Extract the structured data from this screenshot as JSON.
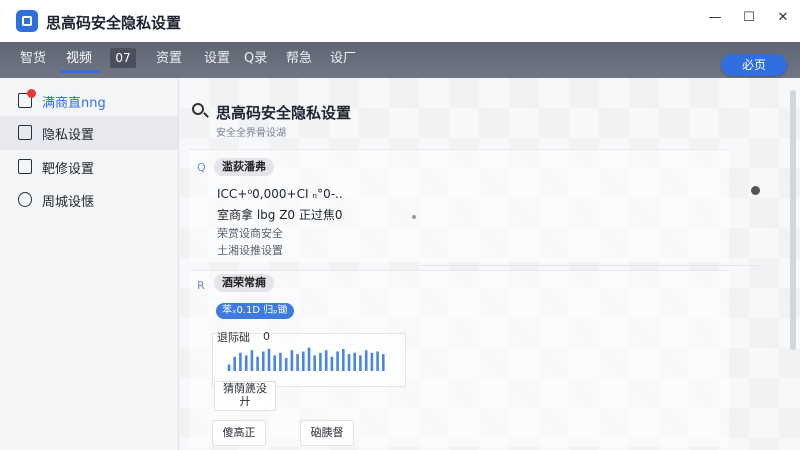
{
  "window": {
    "title": "思高码安全隐私设置",
    "controls": {
      "minimize": "—",
      "maximize": "☐",
      "close": "✕"
    }
  },
  "menubar": {
    "items": [
      "智货",
      "视频",
      "资置",
      "设置",
      "Q录",
      "帮急",
      "设厂"
    ],
    "active_index": 1,
    "box_label": "07",
    "action_button": "必页"
  },
  "sidebar": {
    "items": [
      {
        "label": "满商直nng",
        "icon": "bell-icon",
        "badge": true
      },
      {
        "label": "隐私设置",
        "icon": "document-icon",
        "selected": true
      },
      {
        "label": "靶修设置",
        "icon": "page-icon"
      },
      {
        "label": "周城设惬",
        "icon": "gear-icon"
      }
    ]
  },
  "main": {
    "title": "思高码安全隐私设置",
    "subtitle": "安全全界骨设湖",
    "section1": {
      "tag": "滥荻潘弗",
      "lines": [
        "ICC+⁰0,000+CⅠ  ₙ°0-..",
        "室商拿 lbg Z0 正过焦0",
        "荣赏设商安全",
        "土湘设推设置"
      ]
    },
    "section2": {
      "icon_text": "R",
      "tag": "酒荣常痈",
      "pill": "苯ₓ0.1D 归ₚ锄",
      "stat_label": "退际础",
      "stat_value": "0",
      "bars": [
        0.25,
        0.55,
        0.7,
        0.6,
        0.8,
        0.55,
        0.75,
        0.85,
        0.6,
        0.7,
        0.5,
        0.8,
        0.65,
        0.75,
        0.9,
        0.6,
        0.7,
        0.8,
        0.55,
        0.75,
        0.85,
        0.65,
        0.7,
        0.6,
        0.8,
        0.7,
        0.75,
        0.65
      ],
      "stepper_label": "猜荫篪没",
      "stepper_value": "廾",
      "btn_left": "傻高正",
      "btn_right": "硇胰督"
    }
  },
  "colors": {
    "accent": "#2f6fe0",
    "menubar": "#666c79",
    "sidebar": "#f4f5f7"
  }
}
